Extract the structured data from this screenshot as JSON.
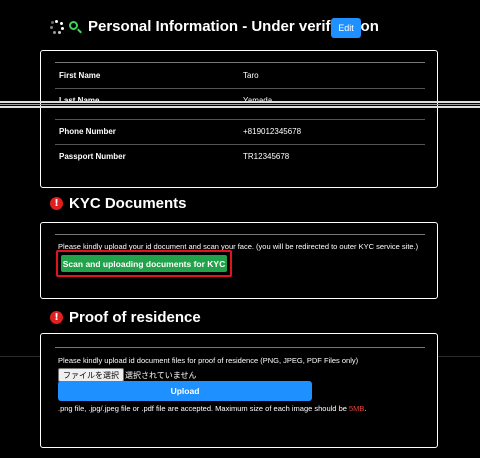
{
  "personal": {
    "title": "Personal Information - Under verification",
    "edit_label": "Edit",
    "rows": [
      {
        "label": "First Name",
        "value": "Taro"
      },
      {
        "label": "Last Name",
        "value": "Yamada"
      },
      {
        "label": "Phone Number",
        "value": "+819012345678"
      },
      {
        "label": "Passport Number",
        "value": "TR12345678"
      }
    ]
  },
  "kyc": {
    "title": "KYC Documents",
    "description": "Please kindly upload your id document and scan your face. (you will be redirected to outer KYC service site.)",
    "button_label": "Scan and uploading documents for KYC"
  },
  "residence": {
    "title": "Proof of residence",
    "description": "Please kindly upload id document files for proof of residence (PNG, JPEG, PDF Files only)",
    "choose_file_label": "ファイルを選択",
    "no_file_label": "選択されていません",
    "upload_label": "Upload",
    "hint_prefix": ".png file, .jpg/.jpeg file or .pdf file are accepted. Maximum size of each image should be ",
    "hint_size": "5MB",
    "hint_suffix": "."
  },
  "colors": {
    "accent_blue": "#1e90ff",
    "kyc_green": "#22a24a",
    "highlight_red": "#e0141e",
    "warning_red": "#e02020"
  }
}
